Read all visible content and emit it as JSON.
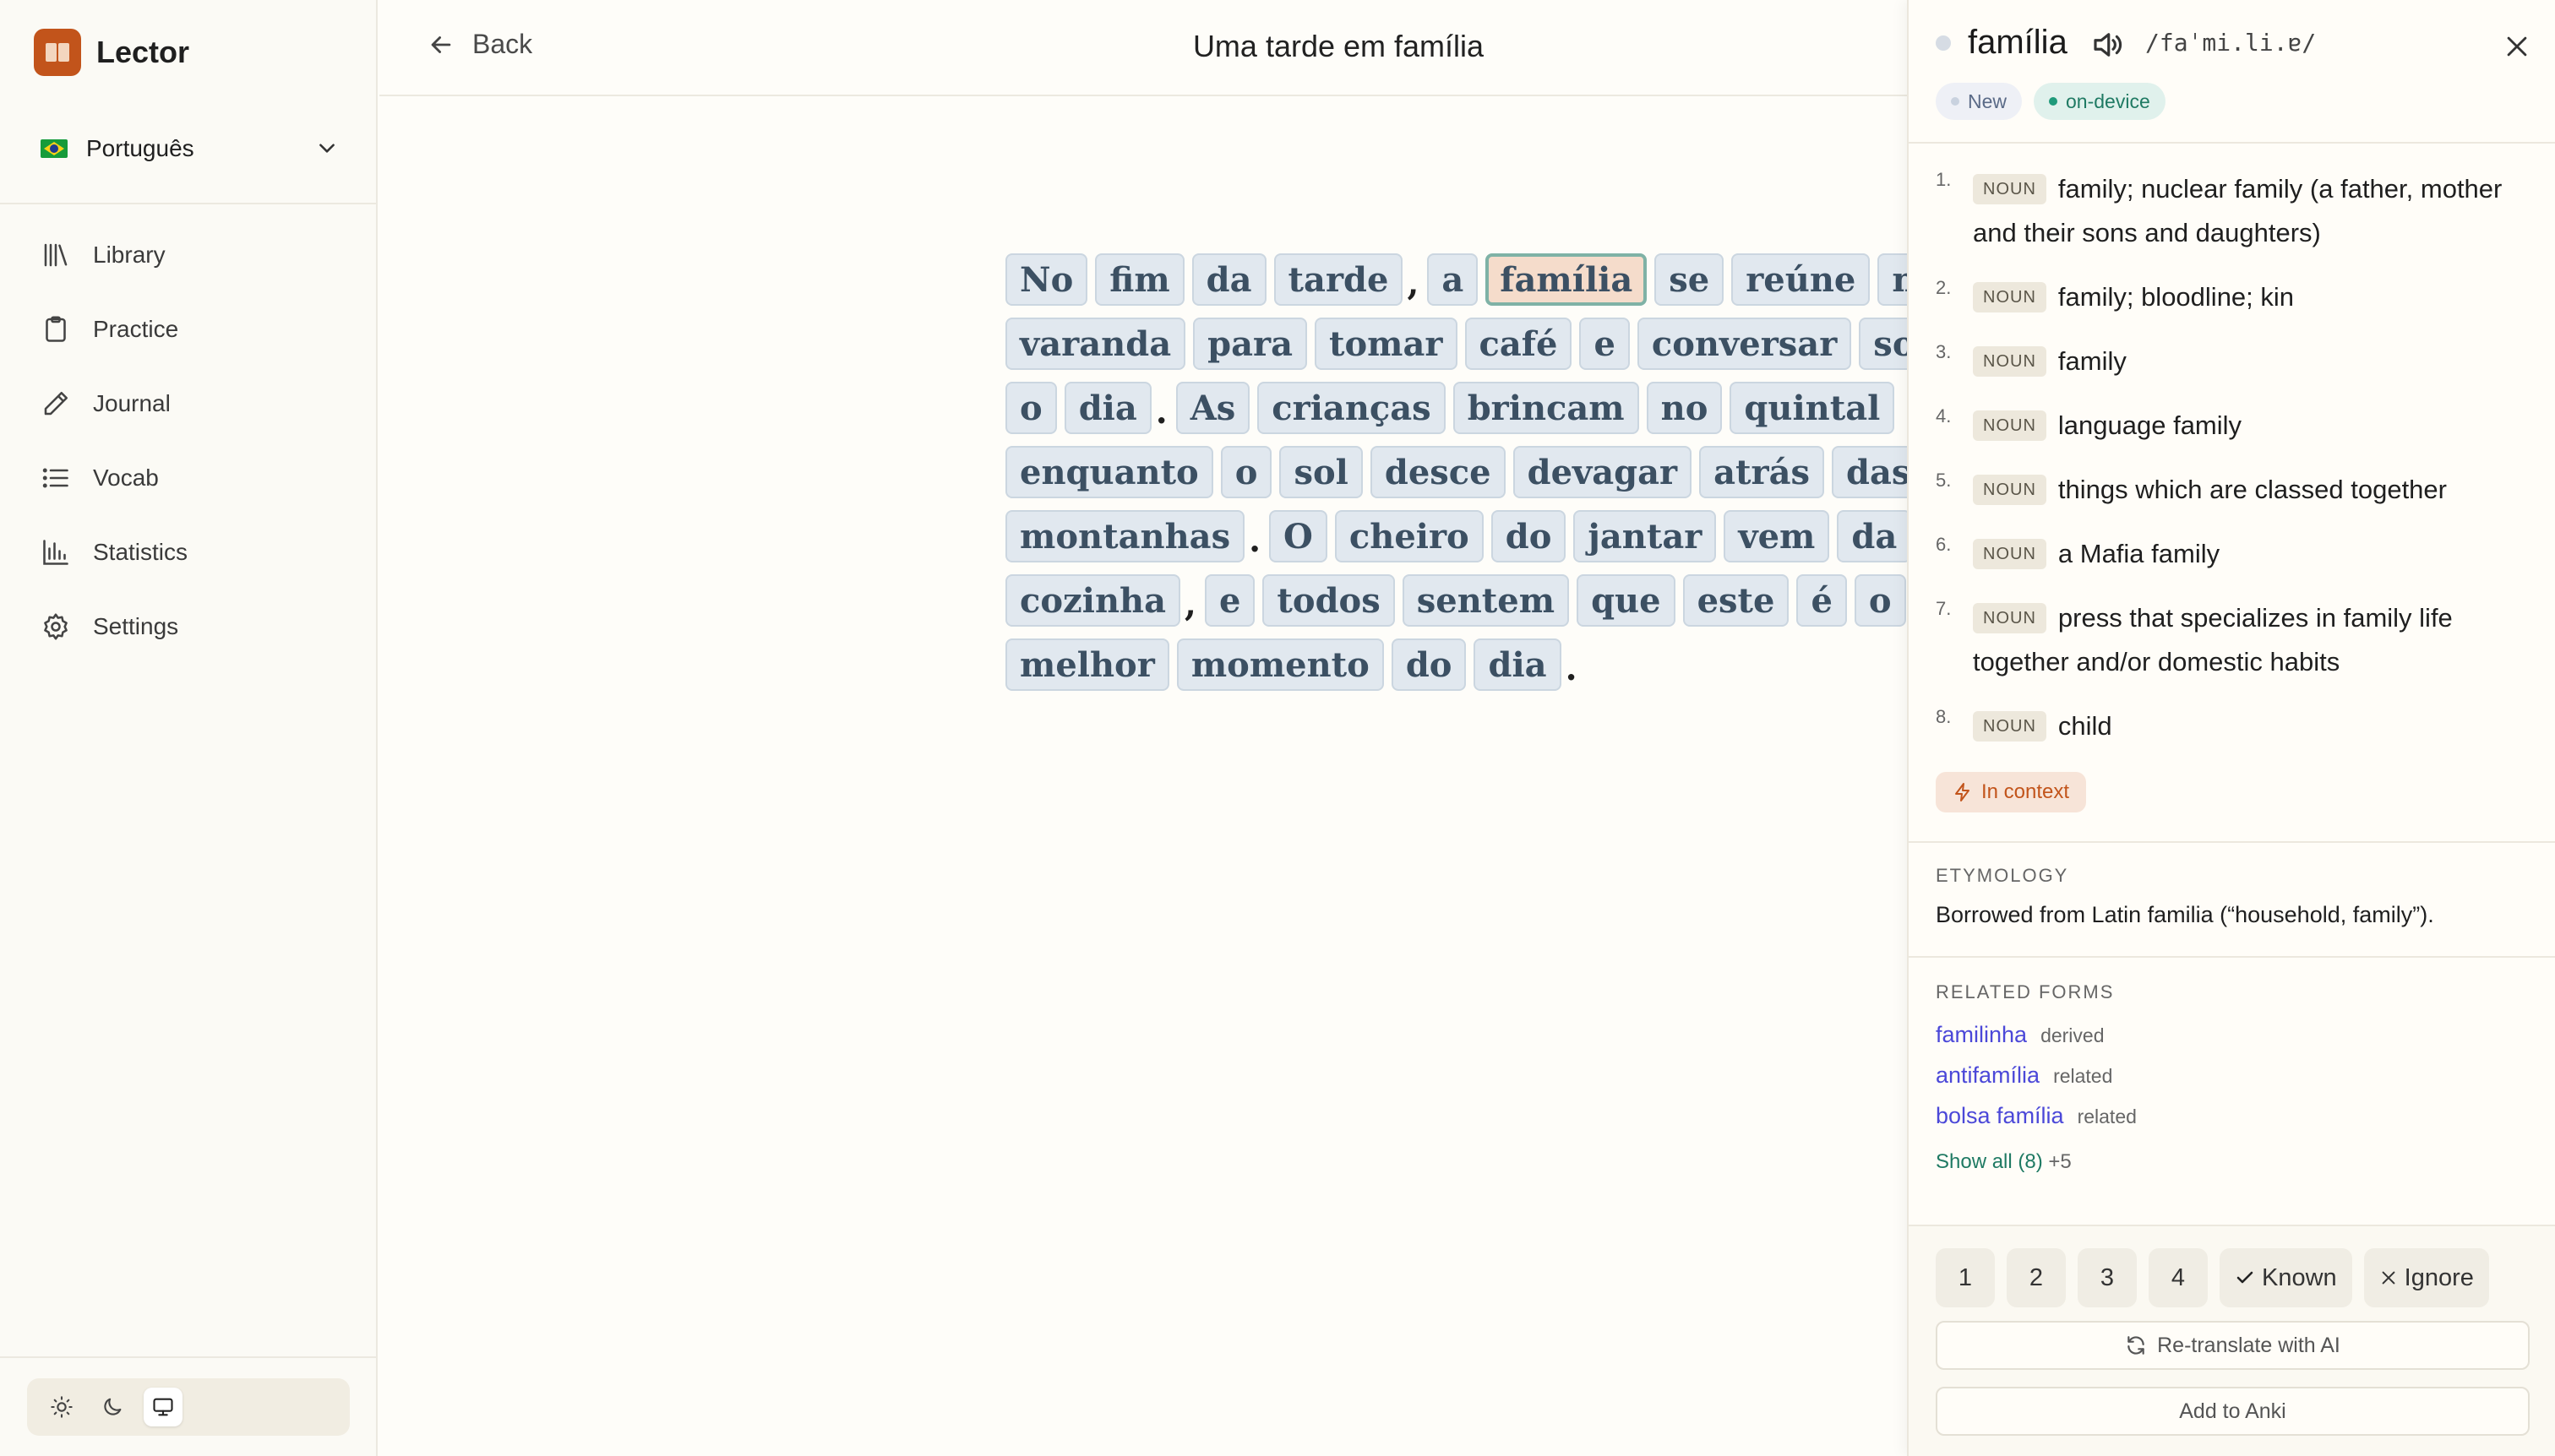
{
  "app": {
    "name": "Lector"
  },
  "language": {
    "selected": "Português"
  },
  "sidebar": {
    "items": [
      {
        "label": "Library",
        "icon": "library-icon"
      },
      {
        "label": "Practice",
        "icon": "clipboard-icon"
      },
      {
        "label": "Journal",
        "icon": "pencil-icon"
      },
      {
        "label": "Vocab",
        "icon": "list-icon"
      },
      {
        "label": "Statistics",
        "icon": "bar-chart-icon"
      },
      {
        "label": "Settings",
        "icon": "gear-icon"
      }
    ],
    "theme": {
      "options": [
        "light",
        "dark",
        "system"
      ],
      "selected": "system"
    }
  },
  "header": {
    "back_label": "Back",
    "title": "Uma tarde em família"
  },
  "reader": {
    "lines": [
      [
        "No",
        "fim",
        "da",
        "tarde",
        ",",
        "a",
        "família",
        "se",
        "reúne",
        "na"
      ],
      [
        "varanda",
        "para",
        "tomar",
        "café",
        "e",
        "conversar",
        "sobre"
      ],
      [
        "o",
        "dia",
        ".",
        "As",
        "crianças",
        "brincam",
        "no",
        "quintal"
      ],
      [
        "enquanto",
        "o",
        "sol",
        "desce",
        "devagar",
        "atrás",
        "das"
      ],
      [
        "montanhas",
        ".",
        "O",
        "cheiro",
        "do",
        "jantar",
        "vem",
        "da"
      ],
      [
        "cozinha",
        ",",
        "e",
        "todos",
        "sentem",
        "que",
        "este",
        "é",
        "o"
      ],
      [
        "melhor",
        "momento",
        "do",
        "dia",
        "."
      ]
    ],
    "selected_word": "família",
    "colors": {
      "token_bg": "#e1e8ef",
      "token_text": "#3c5063",
      "selected_bg": "#f5dccb",
      "selected_border": "#7fb2a6"
    }
  },
  "panel": {
    "word": "família",
    "ipa": "/faˈmi.li.ɐ/",
    "chips": {
      "status": "New",
      "source": "on-device"
    },
    "definitions": [
      {
        "num": "1.",
        "pos": "NOUN",
        "text": "family; nuclear family (a father, mother and their sons and daughters)"
      },
      {
        "num": "2.",
        "pos": "NOUN",
        "text": "family; bloodline; kin"
      },
      {
        "num": "3.",
        "pos": "NOUN",
        "text": "family"
      },
      {
        "num": "4.",
        "pos": "NOUN",
        "text": "language family"
      },
      {
        "num": "5.",
        "pos": "NOUN",
        "text": "things which are classed together"
      },
      {
        "num": "6.",
        "pos": "NOUN",
        "text": "a Mafia family"
      },
      {
        "num": "7.",
        "pos": "NOUN",
        "text": "press that specializes in family life together and/or domestic habits"
      },
      {
        "num": "8.",
        "pos": "NOUN",
        "text": "child"
      }
    ],
    "in_context_label": "In context",
    "etymology": {
      "heading": "ETYMOLOGY",
      "text": "Borrowed from Latin familia (“household, family”)."
    },
    "related": {
      "heading": "RELATED FORMS",
      "items": [
        {
          "word": "familinha",
          "kind": "derived"
        },
        {
          "word": "antifamília",
          "kind": "related"
        },
        {
          "word": "bolsa família",
          "kind": "related"
        }
      ],
      "show_all": "Show all (8)",
      "more": "+5"
    },
    "actions": {
      "ratings": [
        "1",
        "2",
        "3",
        "4"
      ],
      "known": "Known",
      "ignore": "Ignore",
      "retranslate": "Re-translate with AI",
      "anki": "Add to Anki"
    },
    "colors": {
      "accent": "#c2541b",
      "link": "#4b48d8",
      "green": "#1f7a63"
    }
  }
}
